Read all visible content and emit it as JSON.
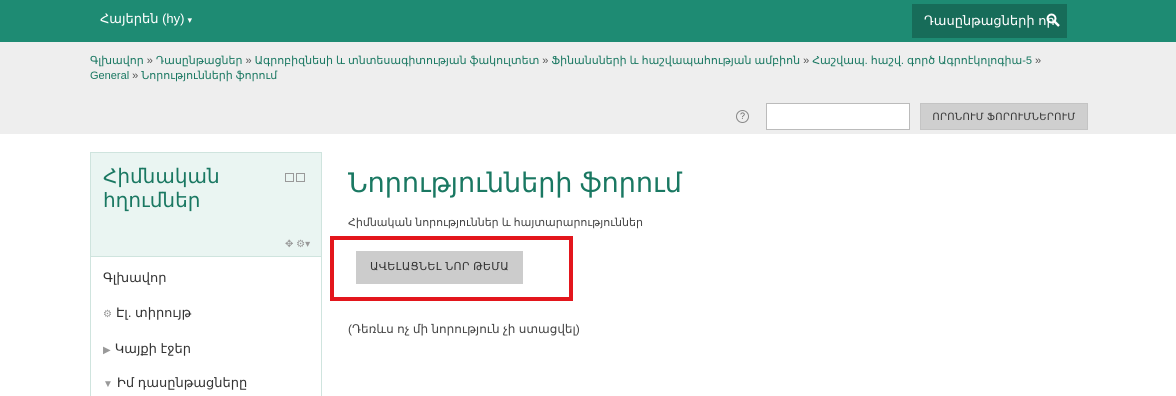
{
  "topbar": {
    "language": "Հայերեն (hy)",
    "course_search": "Դասընթացների որ",
    "search_icon": "search-icon"
  },
  "breadcrumb": {
    "items": [
      "Գլխավոր",
      "Դասընթացներ",
      "Ագրոբիզնեսի և տնտեսագիտության ֆակուլտետ",
      "Ֆինանսների և հաշվապահության ամբիոն",
      "Հաշվապ. հաշվ. գործ Ագրոէկոլոգիա-5",
      "General",
      "Նորությունների ֆորում"
    ],
    "separator": "»"
  },
  "forum_search": {
    "help": "?",
    "value": "",
    "button": "ՈՐՈՆՈՒՄ ՖՈՐՈՒՄՆԵՐՈՒՄ"
  },
  "sidebar": {
    "title": "Հիմնական հղումներ",
    "items": [
      {
        "label": "Գլխավոր",
        "icon": ""
      },
      {
        "label": "Էլ. տիրույթ",
        "icon": "dashboard-icon"
      },
      {
        "label": "Կայքի էջեր",
        "icon": "caret-right-icon"
      },
      {
        "label": "Իմ դասընթացները",
        "icon": "caret-down-icon"
      }
    ]
  },
  "main": {
    "title": "Նորությունների ֆորում",
    "subtitle": "Հիմնական նորություններ և հայտարարություններ",
    "add_button": "ԱՎԵԼԱՑՆԵԼ ՆՈՐ ԹԵՄԱ",
    "empty": "(Դեռևս ոչ մի նորություն չի ստացվել)"
  },
  "colors": {
    "brand": "#1e8b73",
    "highlight": "#e3161c"
  }
}
